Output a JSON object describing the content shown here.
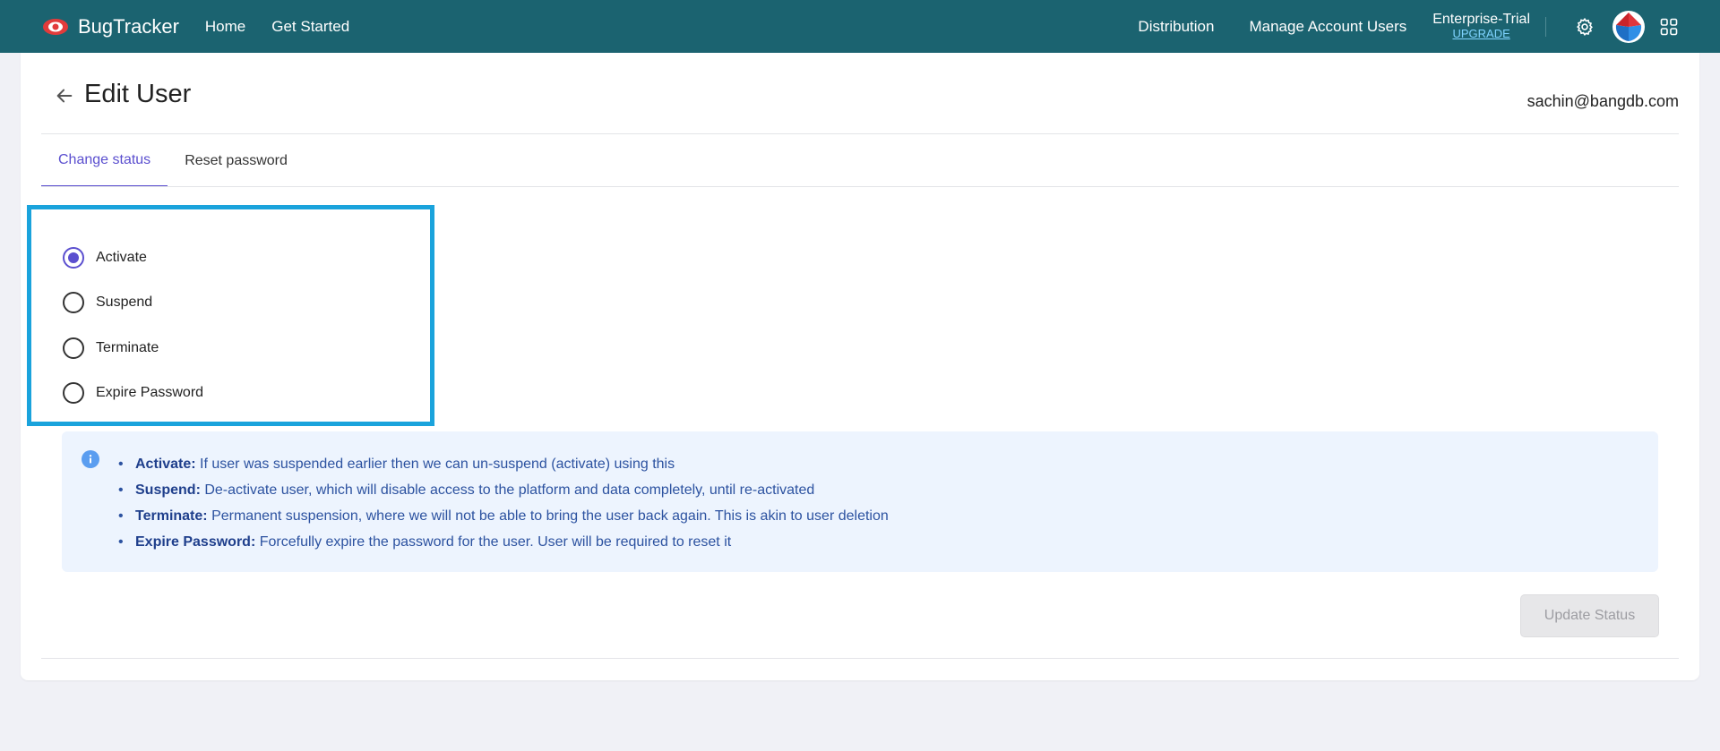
{
  "nav": {
    "brand": "BugTracker",
    "links_left": [
      "Home",
      "Get Started"
    ],
    "links_right": [
      "Distribution",
      "Manage Account Users"
    ],
    "plan_name": "Enterprise-Trial",
    "plan_upgrade": "UPGRADE",
    "icons": [
      "gear-icon",
      "avatar",
      "apps-grid-icon"
    ],
    "bar_color": "#1b6370"
  },
  "page": {
    "title": "Edit User",
    "user_email": "sachin@bangdb.com",
    "tabs": [
      {
        "label": "Change status",
        "active": true
      },
      {
        "label": "Reset password",
        "active": false
      }
    ]
  },
  "status_options": [
    {
      "label": "Activate",
      "checked": true
    },
    {
      "label": "Suspend",
      "checked": false
    },
    {
      "label": "Terminate",
      "checked": false
    },
    {
      "label": "Expire Password",
      "checked": false
    }
  ],
  "info": {
    "items": [
      {
        "term": "Activate:",
        "desc": "If user was suspended earlier then we can un-suspend (activate) using this"
      },
      {
        "term": "Suspend:",
        "desc": "De-activate user, which will disable access to the platform and data completely, until re-activated"
      },
      {
        "term": "Terminate:",
        "desc": "Permanent suspension, where we will not be able to bring the user back again. This is akin to user deletion"
      },
      {
        "term": "Expire Password:",
        "desc": "Forcefully expire the password for the user. User will be required to reset it"
      }
    ]
  },
  "actions": {
    "update_label": "Update Status",
    "update_disabled": true
  },
  "colors": {
    "accent": "#5b4fcf",
    "highlight_border": "#1aa3dc",
    "info_bg": "#edf4fe"
  }
}
